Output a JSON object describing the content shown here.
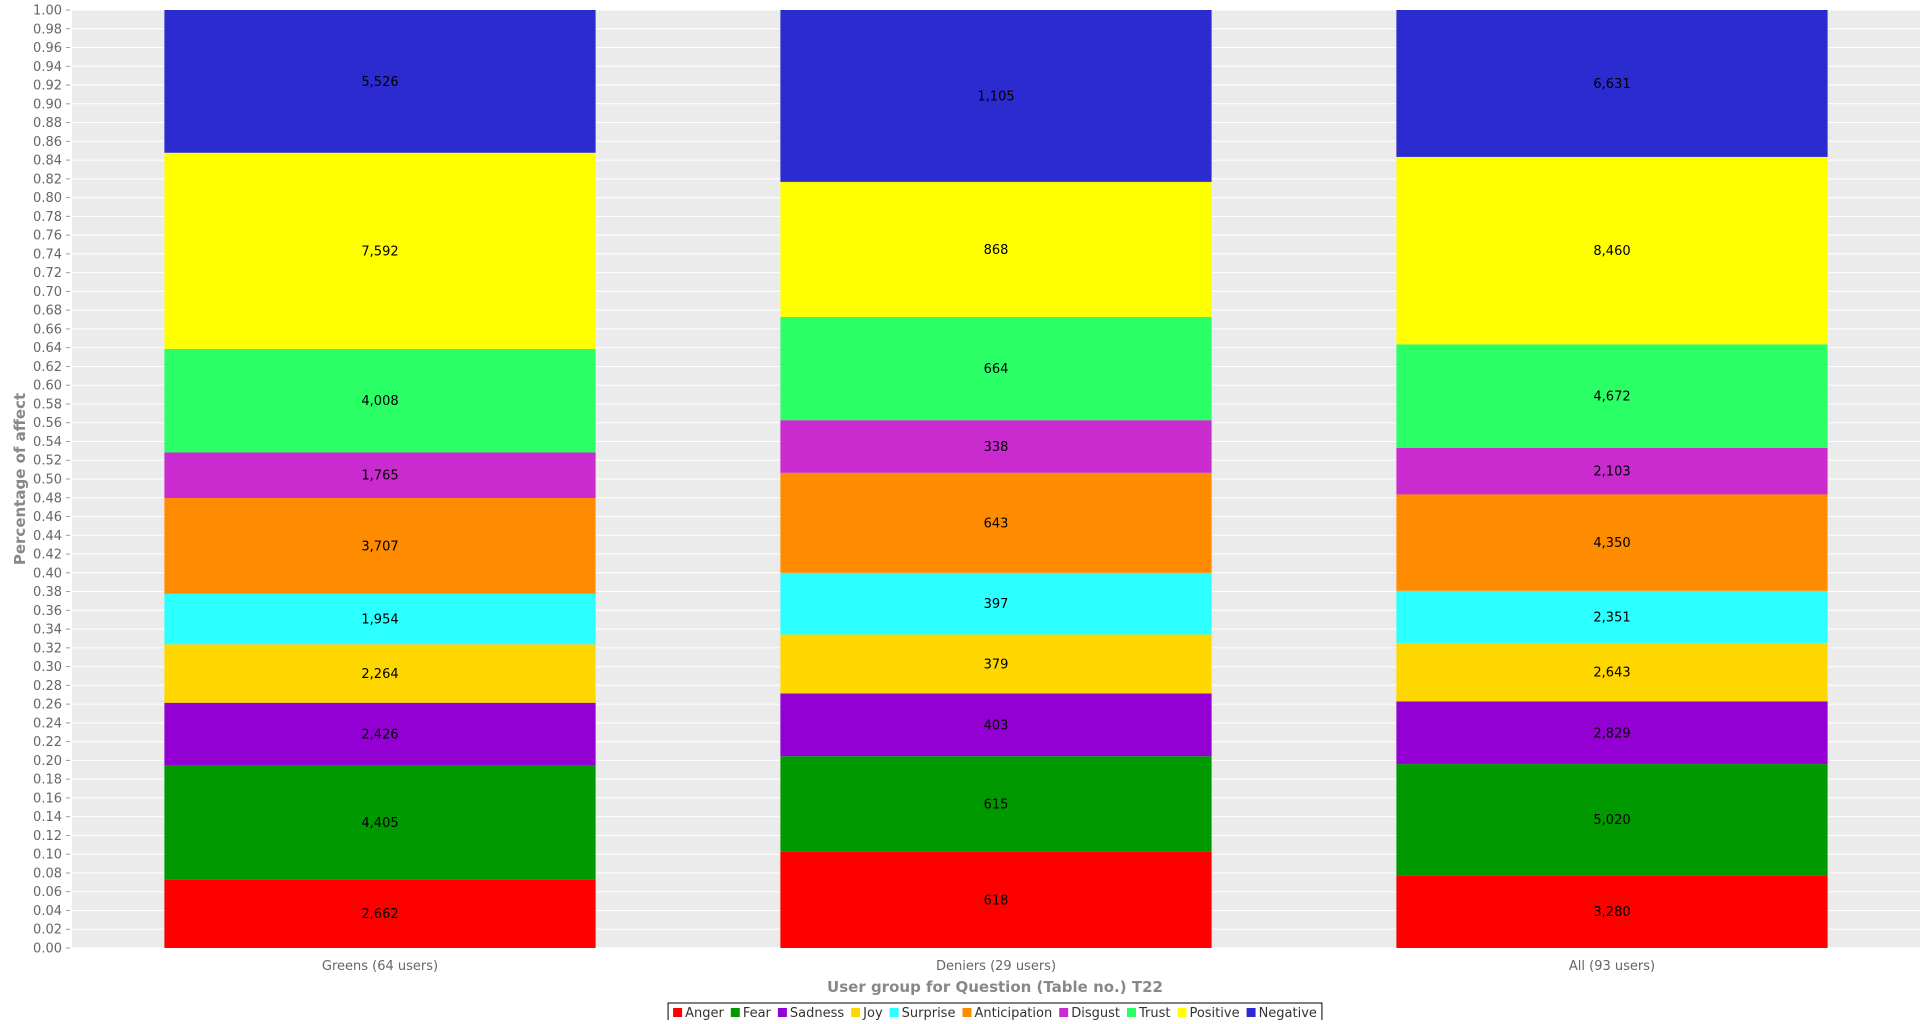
{
  "chart_data": {
    "type": "bar",
    "stacked": true,
    "normalized": true,
    "xlabel": "User group for Question (Table no.) T22",
    "ylabel": "Percentage of affect",
    "ylim": [
      0,
      1.0
    ],
    "ytick_step": 0.02,
    "grid": true,
    "legend_position": "bottom",
    "categories": [
      "Greens (64 users)",
      "Deniers (29 users)",
      "All (93 users)"
    ],
    "series": [
      {
        "name": "Anger",
        "color": "#ff0000",
        "values": [
          2662,
          618,
          3280
        ],
        "labels": [
          "2,662",
          "618",
          "3,280"
        ]
      },
      {
        "name": "Fear",
        "color": "#009900",
        "values": [
          4405,
          615,
          5020
        ],
        "labels": [
          "4,405",
          "615",
          "5,020"
        ]
      },
      {
        "name": "Sadness",
        "color": "#9400d3",
        "values": [
          2426,
          403,
          2829
        ],
        "labels": [
          "2,426",
          "403",
          "2,829"
        ]
      },
      {
        "name": "Joy",
        "color": "#ffd700",
        "values": [
          2264,
          379,
          2643
        ],
        "labels": [
          "2,264",
          "379",
          "2,643"
        ]
      },
      {
        "name": "Surprise",
        "color": "#2bffff",
        "values": [
          1954,
          397,
          2351
        ],
        "labels": [
          "1,954",
          "397",
          "2,351"
        ]
      },
      {
        "name": "Anticipation",
        "color": "#ff8c00",
        "values": [
          3707,
          643,
          4350
        ],
        "labels": [
          "3,707",
          "643",
          "4,350"
        ]
      },
      {
        "name": "Disgust",
        "color": "#c92bcf",
        "values": [
          1765,
          338,
          2103
        ],
        "labels": [
          "1,765",
          "338",
          "2,103"
        ]
      },
      {
        "name": "Trust",
        "color": "#2bff66",
        "values": [
          4008,
          664,
          4672
        ],
        "labels": [
          "4,008",
          "664",
          "4,672"
        ]
      },
      {
        "name": "Positive",
        "color": "#ffff00",
        "values": [
          7592,
          868,
          8460
        ],
        "labels": [
          "7,592",
          "868",
          "8,460"
        ]
      },
      {
        "name": "Negative",
        "color": "#2b2bcf",
        "values": [
          5526,
          1105,
          6631
        ],
        "labels": [
          "5,526",
          "1,105",
          "6,631"
        ]
      }
    ]
  }
}
